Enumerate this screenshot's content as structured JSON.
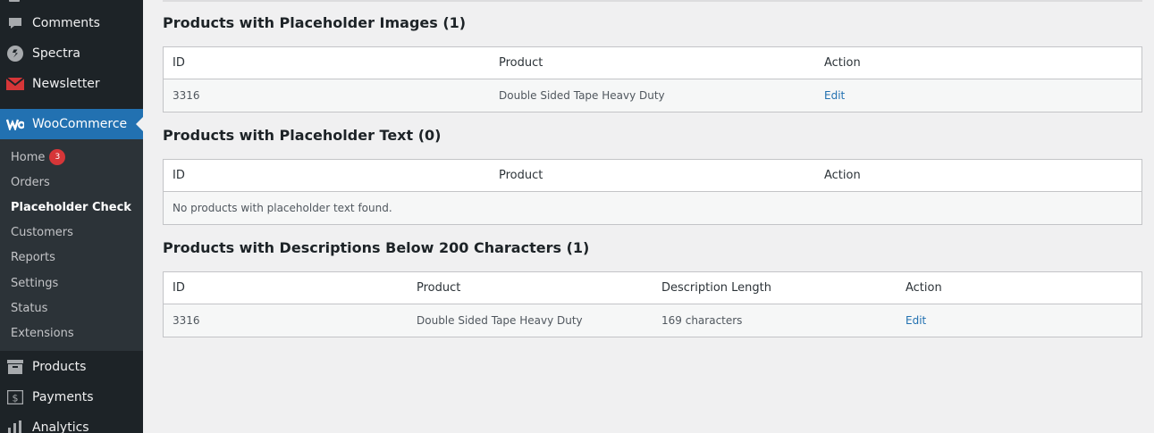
{
  "sidebar": {
    "menu": {
      "comments": "Comments",
      "spectra": "Spectra",
      "newsletter": "Newsletter",
      "woocommerce": "WooCommerce",
      "products": "Products",
      "payments": "Payments",
      "analytics": "Analytics"
    },
    "submenu": {
      "home": "Home",
      "home_badge": "3",
      "orders": "Orders",
      "placeholder_check": "Placeholder Check",
      "customers": "Customers",
      "reports": "Reports",
      "settings": "Settings",
      "status": "Status",
      "extensions": "Extensions"
    }
  },
  "sections": {
    "images": {
      "title": "Products with Placeholder Images (1)",
      "headers": [
        "ID",
        "Product",
        "Action"
      ],
      "rows": [
        {
          "id": "3316",
          "product": "Double Sided Tape Heavy Duty",
          "action": "Edit"
        }
      ]
    },
    "text": {
      "title": "Products with Placeholder Text (0)",
      "headers": [
        "ID",
        "Product",
        "Action"
      ],
      "empty": "No products with placeholder text found."
    },
    "descriptions": {
      "title": "Products with Descriptions Below 200 Characters (1)",
      "headers": [
        "ID",
        "Product",
        "Description Length",
        "Action"
      ],
      "rows": [
        {
          "id": "3316",
          "product": "Double Sided Tape Heavy Duty",
          "length": "169 characters",
          "action": "Edit"
        }
      ]
    }
  },
  "colors": {
    "sidebar_bg": "#1d2327",
    "accent": "#2271b1",
    "badge": "#d63638"
  }
}
